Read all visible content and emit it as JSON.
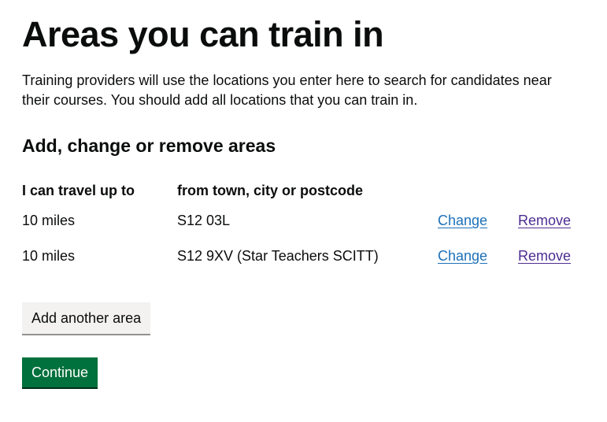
{
  "page": {
    "title": "Areas you can train in",
    "intro": "Training providers will use the locations you enter here to search for candidates near their courses. You should add all locations that you can train in.",
    "section_heading": "Add, change or remove areas"
  },
  "table": {
    "headers": {
      "distance": "I can travel up to",
      "location": "from town, city or postcode"
    },
    "rows": [
      {
        "distance": "10 miles",
        "location": "S12 03L",
        "change_label": "Change",
        "remove_label": "Remove"
      },
      {
        "distance": "10 miles",
        "location": "S12 9XV (Star Teachers SCITT)",
        "change_label": "Change",
        "remove_label": "Remove"
      }
    ]
  },
  "actions": {
    "add_area_label": "Add another area",
    "continue_label": "Continue"
  },
  "colors": {
    "text": "#0b0c0c",
    "link": "#1d70b8",
    "link_visited": "#4c2c92",
    "primary_button": "#00703c",
    "secondary_button": "#f3f2f1"
  }
}
